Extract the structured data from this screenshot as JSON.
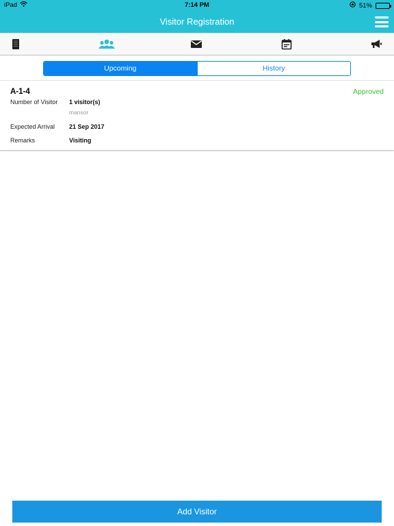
{
  "status_bar": {
    "device": "iPad",
    "time": "7:14 PM",
    "battery_percent": "51%",
    "battery_level": 0.51
  },
  "nav": {
    "title": "Visitor Registration",
    "menu_icon": "hamburger-menu-icon"
  },
  "toolbar": {
    "icons": [
      "document-icon",
      "visitors-group-icon",
      "mail-icon",
      "calendar-icon",
      "megaphone-icon"
    ],
    "active_index": 1,
    "active_color": "#27c1d6"
  },
  "tabs": {
    "items": [
      {
        "label": "Upcoming",
        "selected": true
      },
      {
        "label": "History",
        "selected": false
      }
    ]
  },
  "visit": {
    "unit": "A-1-4",
    "status": "Approved",
    "number_label": "Number of Visitor",
    "number_value": "1 visitor(s)",
    "visitor_name": "mansor",
    "arrival_label": "Expected Arrival",
    "arrival_value": "21 Sep 2017",
    "remarks_label": "Remarks",
    "remarks_value": "Visiting"
  },
  "actions": {
    "add_visitor": "Add Visitor"
  },
  "colors": {
    "header": "#27c1d6",
    "accent": "#0a84f0",
    "approved": "#32c932",
    "button": "#1a96e0"
  }
}
